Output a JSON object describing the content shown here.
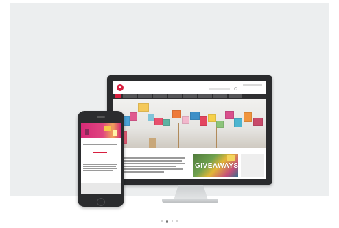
{
  "desktop": {
    "logo_glyph": "★",
    "brand_text": "",
    "nav_item_count": 9,
    "content_title": "",
    "giveaway_label": "GIVEAWAYS",
    "sidebar_label": ""
  },
  "phone": {
    "content_title": ""
  },
  "carousel": {
    "slide_count": 4,
    "active_index": 1
  },
  "colors": {
    "background": "#eceeef",
    "brand": "#d81f3f",
    "device_frame": "#2a2b2d",
    "nav_bar": "#2f2f31",
    "phone_header": "#d62a77"
  },
  "icons": [
    "logo-icon",
    "search-icon",
    "home-button-icon"
  ]
}
